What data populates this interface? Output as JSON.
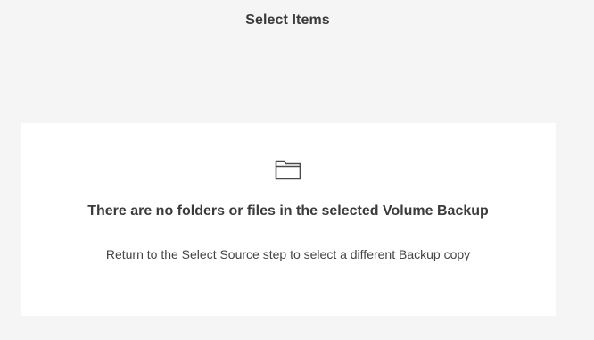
{
  "header": {
    "title": "Select Items"
  },
  "empty_state": {
    "icon": "folder-icon",
    "title": "There are no folders or files in the selected Volume Backup",
    "message": "Return to the Select Source step to select a different Backup copy"
  },
  "colors": {
    "page_background": "#f5f5f5",
    "panel_background": "#ffffff",
    "text": "#3b3b3b"
  }
}
